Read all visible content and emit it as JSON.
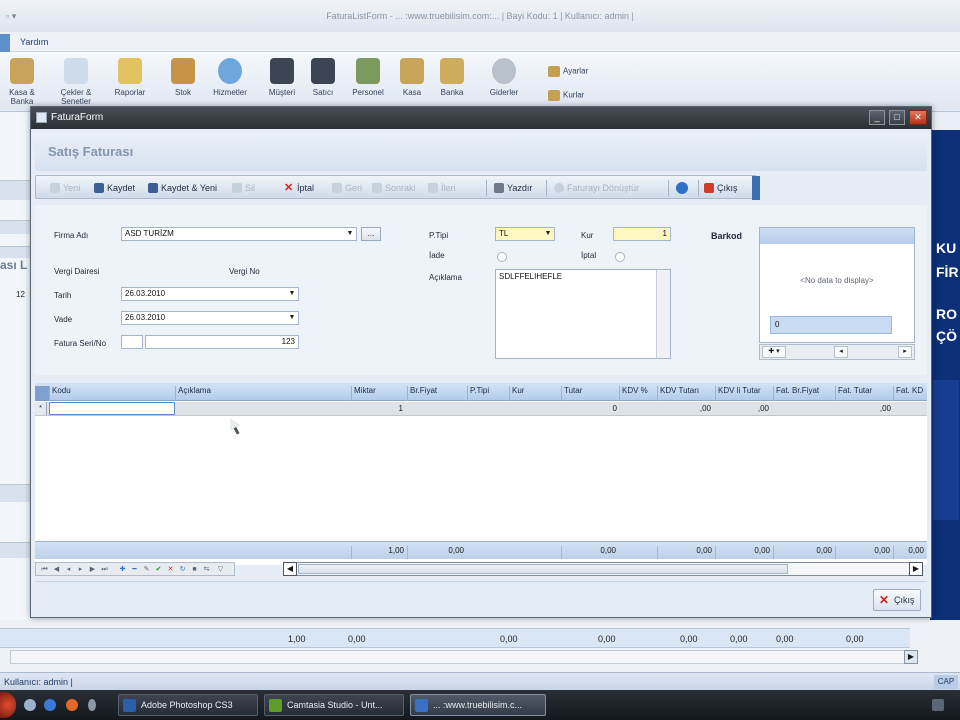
{
  "background": {
    "window_title": "FaturaListForm - ... :www.truebilisim.com:... | Bayi Kodu: 1 | Kullanıcı: admin |",
    "menu_help": "Yardım",
    "ribbon": [
      {
        "label": "Kasa & Banka",
        "icon": "cash-bank-icon"
      },
      {
        "label": "Çekler & Senetler",
        "icon": "cheques-icon"
      },
      {
        "label": "Raporlar",
        "icon": "reports-icon"
      },
      {
        "label": "Stok",
        "icon": "stock-icon"
      },
      {
        "label": "Hizmetler",
        "icon": "services-icon"
      },
      {
        "label": "Müşteri",
        "icon": "customer-icon"
      },
      {
        "label": "Satıcı",
        "icon": "seller-icon"
      },
      {
        "label": "Personel",
        "icon": "staff-icon"
      },
      {
        "label": "Kasa",
        "icon": "cashbox-icon"
      },
      {
        "label": "Banka",
        "icon": "bank-icon"
      },
      {
        "label": "Giderler",
        "icon": "expenses-icon"
      }
    ],
    "ribbon_side": {
      "settings": "Ayarlar",
      "rates": "Kurlar"
    },
    "left_partial_title": "ası L",
    "left_numbers": [
      "12"
    ],
    "totals": [
      "1,00",
      "0,00",
      "0,00",
      "0,00",
      "0,00",
      "0,00",
      "0,00",
      "0,00",
      "0,00"
    ],
    "status_user": "Kullanıcı: admin |",
    "status_caps": "CAP",
    "ad_texts": [
      "KU",
      "FİR",
      "RO",
      "ÇÖ"
    ]
  },
  "taskbar": {
    "tasks": [
      {
        "label": "Adobe Photoshop CS3",
        "color": "#2c5fa8"
      },
      {
        "label": "Camtasia Studio - Unt...",
        "color": "#5f9d2a"
      },
      {
        "label": "... :www.truebilisim.c...",
        "color": "#3b6fc2"
      }
    ]
  },
  "dialog": {
    "title": "FaturaForm",
    "header": "Satış Faturası",
    "toolbar": {
      "new": "Yeni",
      "save": "Kaydet",
      "save_new": "Kaydet & Yeni",
      "delete": "Sil",
      "cancel": "İptal",
      "prev": "Geri",
      "prev2": "Sonraki",
      "next": "İleri",
      "print": "Yazdır",
      "convert": "Faturayı Dönüştür",
      "exit": "Çıkış"
    },
    "form": {
      "firma_label": "Firma Adı",
      "firma_value": "ASD TURİZM",
      "vergi_dairesi_label": "Vergi Dairesi",
      "vergi_no_label": "Vergi No",
      "tarih_label": "Tarih",
      "tarih_value": "26.03.2010",
      "vade_label": "Vade",
      "vade_value": "26.03.2010",
      "seri_label": "Fatura Seri/No",
      "seri_value": "",
      "no_value": "123",
      "ptipi_label": "P.Tipi",
      "ptipi_value": "TL",
      "kur_label": "Kur",
      "kur_value": "1",
      "iade_label": "İade",
      "iptal_label": "İptal",
      "aciklama_label": "Açıklama",
      "aciklama_value": "SDLFFELIHEFLE",
      "barkod_label": "Barkod",
      "barkod_nodata": "<No data to display>",
      "barkod_value": "0"
    },
    "grid": {
      "columns": [
        "Kodu",
        "Açıklama",
        "Miktar",
        "Br.Fiyat",
        "P.Tipi",
        "Kur",
        "Tutar",
        "KDV %",
        "KDV Tutarı",
        "KDV li Tutar",
        "Fat. Br.Fiyat",
        "Fat. Tutar",
        "Fat. KD"
      ],
      "row": {
        "indicator": "*",
        "miktar": "1",
        "tutar": "0",
        "kdv_tutari": ",00",
        "kdv_li": ",00",
        "fat_tutar": ",00"
      },
      "footer": [
        "1,00",
        "0,00",
        "0,00",
        "0,00",
        "0,00",
        "0,00",
        "0,00",
        "0,00"
      ]
    },
    "footer": {
      "close": "Çıkış"
    }
  }
}
